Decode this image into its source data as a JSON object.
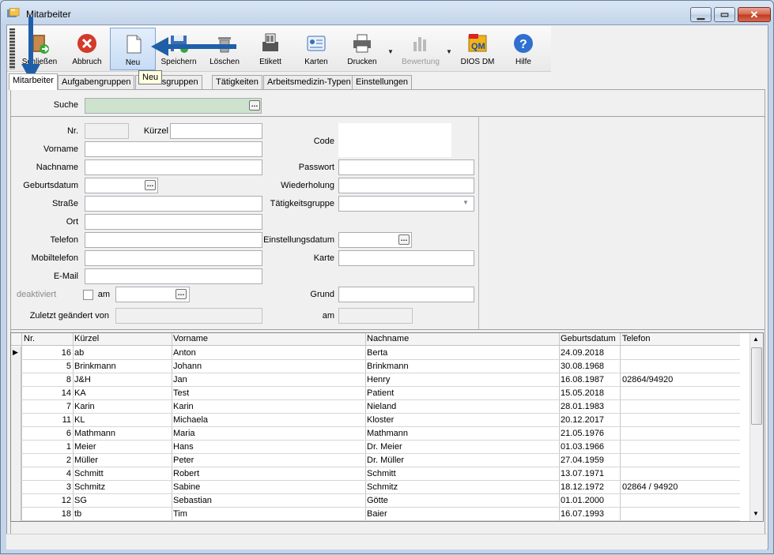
{
  "window": {
    "title": "Mitarbeiter"
  },
  "toolbar": {
    "buttons": [
      {
        "label": "Schließen",
        "icon": "door-exit-icon"
      },
      {
        "label": "Abbruch",
        "icon": "cancel-icon"
      },
      {
        "label": "Neu",
        "icon": "new-document-icon"
      },
      {
        "label": "Speichern",
        "icon": "save-icon"
      },
      {
        "label": "Löschen",
        "icon": "trash-icon"
      },
      {
        "label": "Etikett",
        "icon": "label-printer-icon"
      },
      {
        "label": "Karten",
        "icon": "card-icon"
      },
      {
        "label": "Drucken",
        "icon": "printer-icon"
      },
      {
        "label": "Bewertung",
        "icon": "rating-chart-icon"
      },
      {
        "label": "DIOS DM",
        "icon": "qm-icon"
      },
      {
        "label": "Hilfe",
        "icon": "help-icon"
      }
    ],
    "tooltip": "Neu"
  },
  "tabs": [
    "Mitarbeiter",
    "Aufgabengruppen",
    "Arbeitsgruppen",
    "Tätigkeiten",
    "Arbeitsmedizin-Typen",
    "Einstellungen"
  ],
  "form": {
    "suche": "Suche",
    "nr": "Nr.",
    "kuerzel": "Kürzel",
    "vorname": "Vorname",
    "nachname": "Nachname",
    "geburtsdatum": "Geburtsdatum",
    "strasse": "Straße",
    "ort": "Ort",
    "telefon": "Telefon",
    "mobiltelefon": "Mobiltelefon",
    "email": "E-Mail",
    "deaktiviert": "deaktiviert",
    "am": "am",
    "zuletzt": "Zuletzt geändert von",
    "code": "Code",
    "passwort": "Passwort",
    "wiederholung": "Wiederholung",
    "taetigkeitsgruppe": "Tätigkeitsgruppe",
    "einstellungsdatum": "Einstellungsdatum",
    "karte": "Karte",
    "grund": "Grund",
    "am2": "am"
  },
  "grid": {
    "columns": [
      "Nr.",
      "Kürzel",
      "Vorname",
      "Nachname",
      "Geburtsdatum",
      "Telefon"
    ],
    "rows": [
      {
        "nr": "16",
        "kuerzel": "ab",
        "vorname": "Anton",
        "nachname": "Berta",
        "geb": "24.09.2018",
        "tel": ""
      },
      {
        "nr": "5",
        "kuerzel": "Brinkmann",
        "vorname": "Johann",
        "nachname": "Brinkmann",
        "geb": "30.08.1968",
        "tel": ""
      },
      {
        "nr": "8",
        "kuerzel": "J&H",
        "vorname": "Jan",
        "nachname": "Henry",
        "geb": "16.08.1987",
        "tel": "02864/94920"
      },
      {
        "nr": "14",
        "kuerzel": "KA",
        "vorname": "Test",
        "nachname": "Patient",
        "geb": "15.05.2018",
        "tel": ""
      },
      {
        "nr": "7",
        "kuerzel": "Karin",
        "vorname": "Karin",
        "nachname": "Nieland",
        "geb": "28.01.1983",
        "tel": ""
      },
      {
        "nr": "11",
        "kuerzel": "KL",
        "vorname": "Michaela",
        "nachname": "Kloster",
        "geb": "20.12.2017",
        "tel": ""
      },
      {
        "nr": "6",
        "kuerzel": "Mathmann",
        "vorname": "Maria",
        "nachname": "Mathmann",
        "geb": "21.05.1976",
        "tel": ""
      },
      {
        "nr": "1",
        "kuerzel": "Meier",
        "vorname": "Hans",
        "nachname": "Dr. Meier",
        "geb": "01.03.1966",
        "tel": ""
      },
      {
        "nr": "2",
        "kuerzel": "Müller",
        "vorname": "Peter",
        "nachname": "Dr. Müller",
        "geb": "27.04.1959",
        "tel": ""
      },
      {
        "nr": "4",
        "kuerzel": "Schmitt",
        "vorname": "Robert",
        "nachname": "Schmitt",
        "geb": "13.07.1971",
        "tel": ""
      },
      {
        "nr": "3",
        "kuerzel": "Schmitz",
        "vorname": "Sabine",
        "nachname": "Schmitz",
        "geb": "18.12.1972",
        "tel": "02864 / 94920"
      },
      {
        "nr": "12",
        "kuerzel": "SG",
        "vorname": "Sebastian",
        "nachname": "Götte",
        "geb": "01.01.2000",
        "tel": ""
      },
      {
        "nr": "18",
        "kuerzel": "tb",
        "vorname": "Tim",
        "nachname": "Baier",
        "geb": "16.07.1993",
        "tel": ""
      }
    ]
  },
  "colors": {
    "annotation_arrow": "#1f5fa8",
    "search_field": "#cde3cd"
  }
}
